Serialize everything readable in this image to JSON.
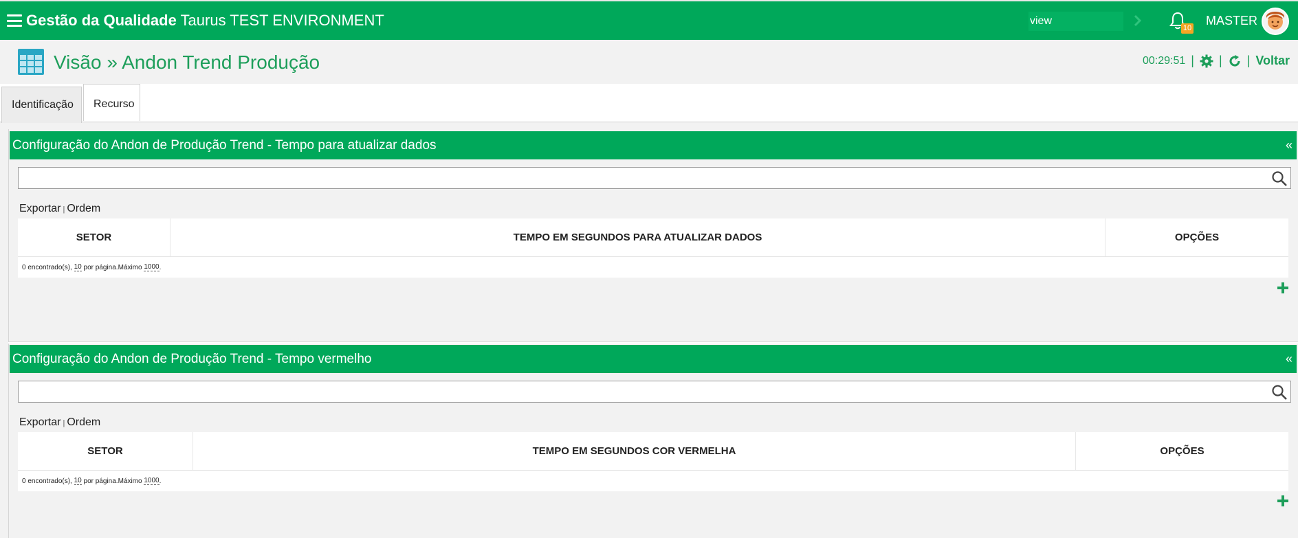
{
  "topbar": {
    "app_name": "Gestão da Qualidade",
    "environment": " Taurus TEST ENVIRONMENT",
    "search_value": "view",
    "notification_count": "10",
    "user": "MASTER",
    "bg_color": "#00a85a"
  },
  "header": {
    "title": "Visão » Andon Trend Produção",
    "timer": "00:29:51",
    "back_label": "Voltar",
    "sep": "|"
  },
  "tabs": [
    {
      "label": "Identificação"
    },
    {
      "label": "Recurso"
    }
  ],
  "panels": [
    {
      "title": "Configuração do Andon de Produção Trend - Tempo para atualizar dados",
      "collapse": "«",
      "export_label": "Exportar",
      "order_label": "Ordem",
      "link_sep": "|",
      "columns": [
        "SETOR",
        "TEMPO EM SEGUNDOS PARA ATUALIZAR DADOS",
        "OPÇÕES"
      ],
      "footer": {
        "found": "0 encontrado(s),",
        "per_page_value": "10",
        "per_page_text": "por página.",
        "max_label": "Máximo",
        "max_value": "1000",
        "end": "."
      }
    },
    {
      "title": "Configuração do Andon de Produção Trend - Tempo vermelho",
      "collapse": "«",
      "export_label": "Exportar",
      "order_label": "Ordem",
      "link_sep": "|",
      "columns": [
        "SETOR",
        "TEMPO EM SEGUNDOS COR VERMELHA",
        "OPÇÕES"
      ],
      "footer": {
        "found": "0 encontrado(s),",
        "per_page_value": "10",
        "per_page_text": "por página.",
        "max_label": "Máximo",
        "max_value": "1000",
        "end": "."
      }
    }
  ],
  "icons": {
    "menu": "hamburger-icon",
    "bell": "bell-icon",
    "settings": "gear-icon",
    "refresh": "refresh-icon",
    "search": "search-icon",
    "add": "plus-icon",
    "page": "table-grid-icon"
  }
}
